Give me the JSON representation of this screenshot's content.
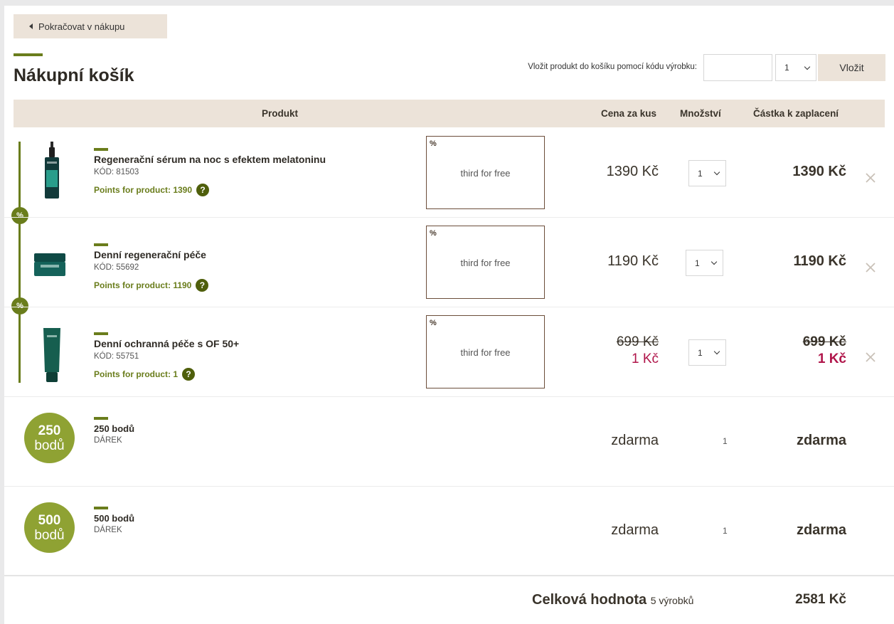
{
  "back_button": {
    "label": "Pokračovat v nákupu"
  },
  "page_title": "Nákupní košík",
  "code_insert": {
    "label": "Vložit produkt do košíku pomocí kódu výrobku:",
    "input_value": "",
    "qty": "1",
    "button_label": "Vložit"
  },
  "table_header": {
    "product": "Produkt",
    "unit_price": "Cena za kus",
    "quantity": "Množství",
    "amount": "Částka k zaplacení"
  },
  "items": [
    {
      "name": "Regenerační sérum na noc s efektem melatoninu",
      "code": "KÓD: 81503",
      "points": "Points for product: 1390",
      "promo_pct": "%",
      "promo_text": "third for free",
      "price": "1390 Kč",
      "qty": "1",
      "total": "1390 Kč",
      "image": "serum-bottle"
    },
    {
      "name": "Denní regenerační péče",
      "code": "KÓD: 55692",
      "points": "Points for product: 1190",
      "promo_pct": "%",
      "promo_text": "third for free",
      "price": "1190 Kč",
      "qty": "1",
      "total": "1190 Kč",
      "image": "cream-jar"
    },
    {
      "name": "Denní ochranná péče s OF 50+",
      "code": "KÓD: 55751",
      "points": "Points for product: 1",
      "promo_pct": "%",
      "promo_text": "third for free",
      "price_old": "699 Kč",
      "price_new": "1 Kč",
      "qty": "1",
      "total_old": "699 Kč",
      "total_new": "1 Kč",
      "image": "cream-tube"
    }
  ],
  "group_badge": "%",
  "help_glyph": "?",
  "gifts": [
    {
      "badge_number": "250",
      "badge_unit": "bodů",
      "name": "250 bodů",
      "type": "DÁREK",
      "price": "zdarma",
      "qty": "1",
      "total": "zdarma"
    },
    {
      "badge_number": "500",
      "badge_unit": "bodů",
      "name": "500 bodů",
      "type": "DÁREK",
      "price": "zdarma",
      "qty": "1",
      "total": "zdarma"
    }
  ],
  "summary": {
    "label": "Celková hodnota",
    "count": "5 výrobků",
    "total": "2581 Kč"
  },
  "colors": {
    "accent_green": "#6a7d1c",
    "badge_green": "#8fa233",
    "beige": "#ece3d9",
    "discount_red": "#b0154a"
  }
}
